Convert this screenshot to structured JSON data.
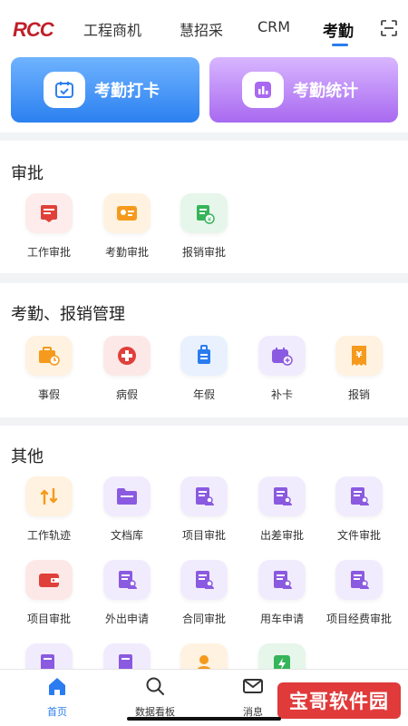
{
  "brand": {
    "logo": "RCC"
  },
  "tabs": [
    {
      "label": "工程商机"
    },
    {
      "label": "慧招采"
    },
    {
      "label": "CRM"
    },
    {
      "label": "考勤"
    }
  ],
  "hero": {
    "checkin": {
      "label": "考勤打卡"
    },
    "stats": {
      "label": "考勤统计"
    }
  },
  "approval": {
    "title": "审批",
    "items": [
      {
        "label": "工作审批",
        "icon": "document-stamp-icon"
      },
      {
        "label": "考勤审批",
        "icon": "id-card-icon"
      },
      {
        "label": "报销审批",
        "icon": "receipt-yen-icon"
      }
    ]
  },
  "attendance": {
    "title": "考勤、报销管理",
    "items": [
      {
        "label": "事假",
        "icon": "briefcase-clock-icon"
      },
      {
        "label": "病假",
        "icon": "medical-cross-icon"
      },
      {
        "label": "年假",
        "icon": "luggage-icon"
      },
      {
        "label": "补卡",
        "icon": "calendar-add-icon"
      },
      {
        "label": "报销",
        "icon": "yen-receipt-icon"
      }
    ]
  },
  "other": {
    "title": "其他",
    "row1": [
      {
        "label": "工作轨迹",
        "icon": "track-arrows-icon"
      },
      {
        "label": "文档库",
        "icon": "folder-icon"
      },
      {
        "label": "项目审批",
        "icon": "form-person-icon"
      },
      {
        "label": "出差审批",
        "icon": "form-person-icon"
      },
      {
        "label": "文件审批",
        "icon": "form-person-icon"
      }
    ],
    "row2": [
      {
        "label": "项目审批",
        "icon": "wallet-icon"
      },
      {
        "label": "外出申请",
        "icon": "form-person-icon"
      },
      {
        "label": "合同审批",
        "icon": "form-person-icon"
      },
      {
        "label": "用车申请",
        "icon": "form-person-icon"
      },
      {
        "label": "项目经费审批",
        "icon": "form-person-icon"
      }
    ]
  },
  "nav": [
    {
      "label": "首页",
      "icon": "home-icon"
    },
    {
      "label": "数据看板",
      "icon": "search-icon"
    },
    {
      "label": "消息",
      "icon": "mail-icon"
    }
  ],
  "watermark": "宝哥软件园",
  "colors": {
    "accent": "#2a7cf0",
    "purple": "#8a5ae0",
    "red": "#e0403a",
    "orange": "#f59a1c",
    "green": "#36b45a"
  }
}
